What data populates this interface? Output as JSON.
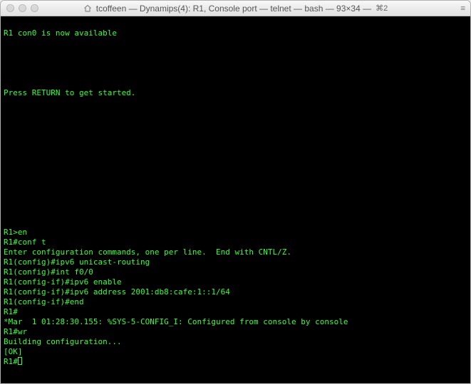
{
  "window": {
    "title": "tcoffeen — Dynamips(4): R1, Console port — telnet — bash — 93×34 —",
    "shortcut": "⌘2"
  },
  "terminal": {
    "lines": [
      "",
      "R1 con0 is now available",
      "",
      "",
      "",
      "",
      "",
      "Press RETURN to get started.",
      "",
      "",
      "",
      "",
      "",
      "",
      "",
      "",
      "",
      "",
      "",
      "",
      "",
      "R1>en",
      "R1#conf t",
      "Enter configuration commands, one per line.  End with CNTL/Z.",
      "R1(config)#ipv6 unicast-routing",
      "R1(config)#int f0/0",
      "R1(config-if)#ipv6 enable",
      "R1(config-if)#ipv6 address 2001:db8:cafe:1::1/64",
      "R1(config-if)#end",
      "R1#",
      "*Mar  1 01:28:30.155: %SYS-5-CONFIG_I: Configured from console by console",
      "R1#wr",
      "Building configuration...",
      "[OK]"
    ],
    "prompt": "R1#"
  }
}
